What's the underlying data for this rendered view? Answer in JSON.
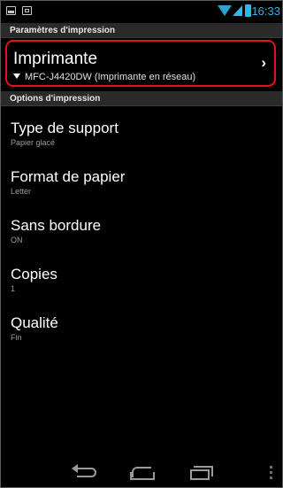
{
  "status_bar": {
    "time": "16:33",
    "icons": [
      "image-icon",
      "screenshot-icon",
      "wifi-icon",
      "signal-icon",
      "battery-icon"
    ],
    "accent_color": "#33b5e5"
  },
  "print_settings": {
    "header": "Paramètres d'impression",
    "printer": {
      "title": "Imprimante",
      "subtitle": "MFC-J4420DW (Imprimante en réseau)",
      "highlight_color": "#e8101a"
    }
  },
  "print_options": {
    "header": "Options d'impression",
    "items": [
      {
        "title": "Type de support",
        "value": "Papier glacé"
      },
      {
        "title": "Format de papier",
        "value": "Letter"
      },
      {
        "title": "Sans bordure",
        "value": "ON"
      },
      {
        "title": "Copies",
        "value": "1"
      },
      {
        "title": "Qualité",
        "value": "Fin"
      }
    ]
  },
  "navbar": {
    "buttons": [
      "back-icon",
      "home-icon",
      "recent-apps-icon",
      "menu-icon"
    ]
  }
}
